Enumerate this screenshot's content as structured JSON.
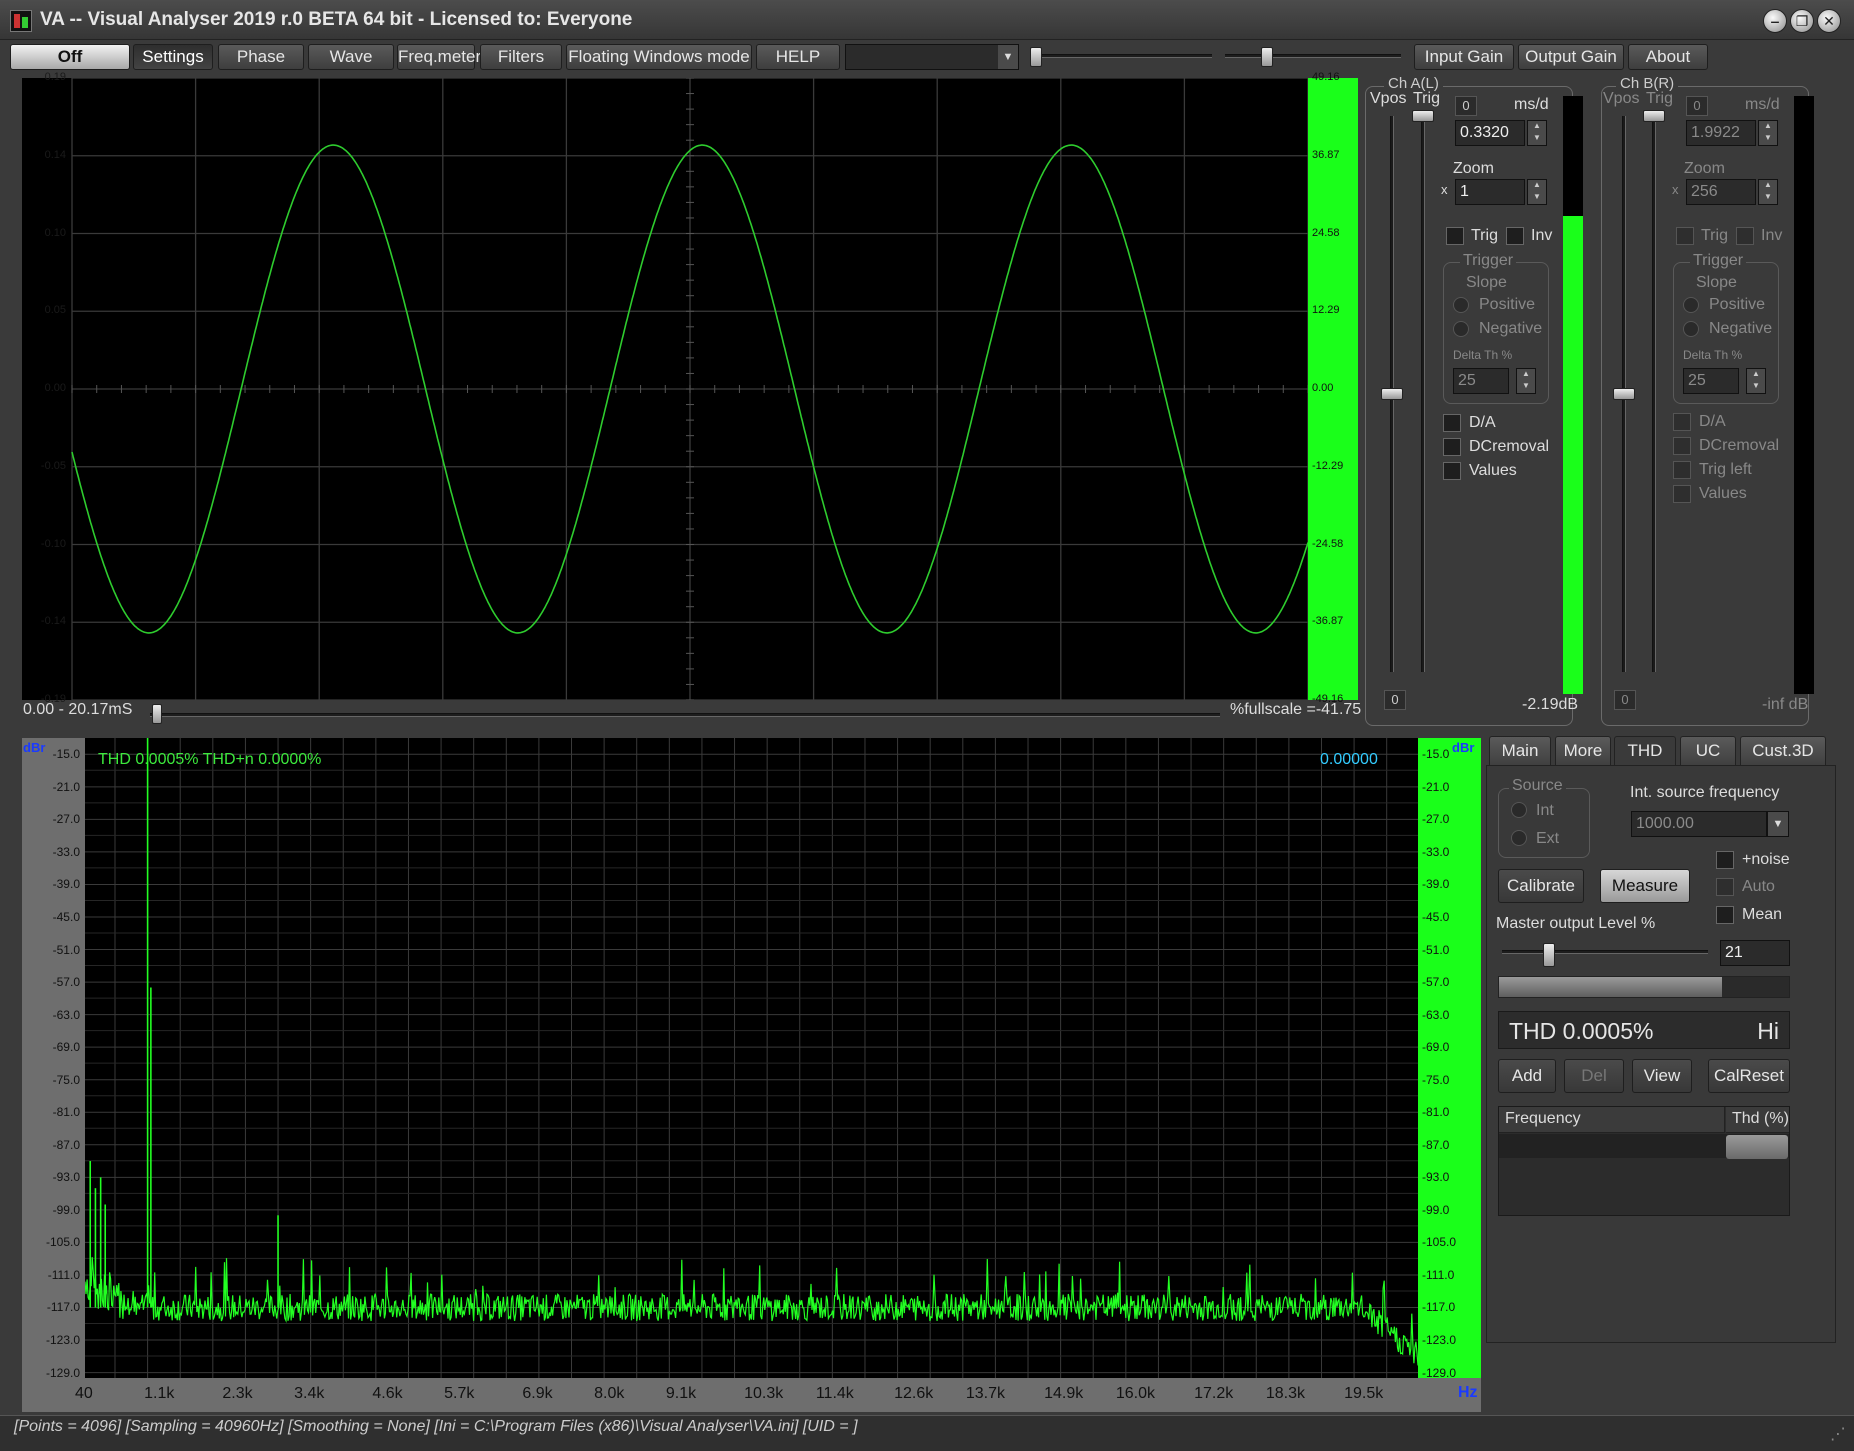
{
  "window": {
    "title": "VA -- Visual Analyser 2019 r.0 BETA 64 bit - Licensed to: Everyone",
    "min": "‒",
    "max": "❐",
    "close": "✕"
  },
  "toolbar": {
    "off": "Off",
    "settings": "Settings",
    "phase": "Phase",
    "wave": "Wave",
    "freqmeter": "Freq.meter",
    "filters": "Filters",
    "floating": "Floating Windows mode",
    "help": "HELP",
    "combo_value": "",
    "input_gain": "Input Gain",
    "output_gain": "Output Gain",
    "about": "About"
  },
  "scope": {
    "y_left": [
      "0.19",
      "0.14",
      "0.10",
      "0.05",
      "0.00",
      "-0.05",
      "-0.10",
      "-0.14",
      "-0.19"
    ],
    "y_right": [
      "49.16",
      "36.87",
      "24.58",
      "12.29",
      "0.00",
      "-12.29",
      "-24.58",
      "-36.87",
      "-49.16"
    ],
    "time_range": "0.00 - 20.17mS",
    "fullscale": "%fullscale =-41.75",
    "wave": {
      "amplitude": 0.149,
      "cycles": 3.35,
      "start_phase_deg": 195,
      "ymax": 0.19
    },
    "colors": {
      "trace": "#2ecc2e",
      "grid": "#3a3a3a",
      "right_axis": "#1aff1a"
    }
  },
  "chA": {
    "title": "Ch A(L)",
    "vpos": "Vpos",
    "trig": "Trig",
    "zero_box": "0",
    "msd": "ms/d",
    "msd_value": "0.3320",
    "zoom": "Zoom",
    "zoom_x": "x",
    "zoom_value": "1",
    "trig_chk": "Trig",
    "inv_chk": "Inv",
    "trigger": "Trigger",
    "slope": "Slope",
    "positive": "Positive",
    "negative": "Negative",
    "delta": "Delta Th %",
    "delta_value": "25",
    "da": "D/A",
    "dcremoval": "DCremoval",
    "values": "Values",
    "bottom_box": "0",
    "level": "-2.19dB",
    "meter_fill": 0.8
  },
  "chB": {
    "title": "Ch B(R)",
    "vpos": "Vpos",
    "trig": "Trig",
    "zero_box": "0",
    "msd": "ms/d",
    "msd_value": "1.9922",
    "zoom": "Zoom",
    "zoom_x": "x",
    "zoom_value": "256",
    "trig_chk": "Trig",
    "inv_chk": "Inv",
    "trigger": "Trigger",
    "slope": "Slope",
    "positive": "Positive",
    "negative": "Negative",
    "delta": "Delta Th %",
    "delta_value": "25",
    "da": "D/A",
    "dcremoval": "DCremoval",
    "trigleft": "Trig left",
    "values": "Values",
    "bottom_box": "0",
    "level": "-inf dB",
    "meter_fill": 0
  },
  "spectrum": {
    "unit_left": "dBr",
    "unit_right": "dBr",
    "thd_label": "THD 0.0005% THD+n 0.0000%",
    "peak_value": "0.00000",
    "y_labels": [
      "-15.0",
      "-21.0",
      "-27.0",
      "-33.0",
      "-39.0",
      "-45.0",
      "-51.0",
      "-57.0",
      "-63.0",
      "-69.0",
      "-75.0",
      "-81.0",
      "-87.0",
      "-93.0",
      "-99.0",
      "-105.0",
      "-111.0",
      "-117.0",
      "-123.0",
      "-129.0"
    ],
    "x_labels": [
      "40",
      "1.1k",
      "2.3k",
      "3.4k",
      "4.6k",
      "5.7k",
      "6.9k",
      "8.0k",
      "9.1k",
      "10.3k",
      "11.4k",
      "12.6k",
      "13.7k",
      "14.9k",
      "16.0k",
      "17.2k",
      "18.3k",
      "19.5k"
    ],
    "x_unit": "Hz",
    "ylim": [
      -130,
      -12
    ],
    "xlim": [
      40,
      20480
    ],
    "noise_floor_db": -117,
    "fundamental_hz": 1000,
    "peaks": [
      {
        "hz": 1000,
        "db": -12
      },
      {
        "hz": 1050,
        "db": -58
      },
      {
        "hz": 3000,
        "db": -100
      },
      {
        "hz": 120,
        "db": -90
      },
      {
        "hz": 200,
        "db": -95
      },
      {
        "hz": 280,
        "db": -93
      },
      {
        "hz": 350,
        "db": -98
      }
    ],
    "colors": {
      "trace": "#22ff22",
      "grid": "#3a3a3a",
      "thd_text": "#3ce83c",
      "peak_text": "#33ccff"
    }
  },
  "rtabs": {
    "main": "Main",
    "more": "More",
    "thd": "THD",
    "uc": "UC",
    "cust3d": "Cust.3D"
  },
  "thd": {
    "source": "Source",
    "int": "Int",
    "ext": "Ext",
    "int_freq_label": "Int. source frequency",
    "int_freq_value": "1000.00",
    "noise": "+noise",
    "auto": "Auto",
    "mean": "Mean",
    "calibrate": "Calibrate",
    "measure": "Measure",
    "master_level": "Master output Level %",
    "level_value": "21",
    "level_fraction": 0.21,
    "progress_fraction": 0.77,
    "display": "THD 0.0005%",
    "display_hi": "Hi",
    "add": "Add",
    "del": "Del",
    "view": "View",
    "calreset": "CalReset",
    "col_frequency": "Frequency",
    "col_thd": "Thd (%)"
  },
  "status": {
    "text": "[Points = 4096]  [Sampling = 40960Hz]  [Smoothing = None]  [Ini = C:\\Program Files (x86)\\Visual Analyser\\VA.ini]  [UID = ]"
  }
}
